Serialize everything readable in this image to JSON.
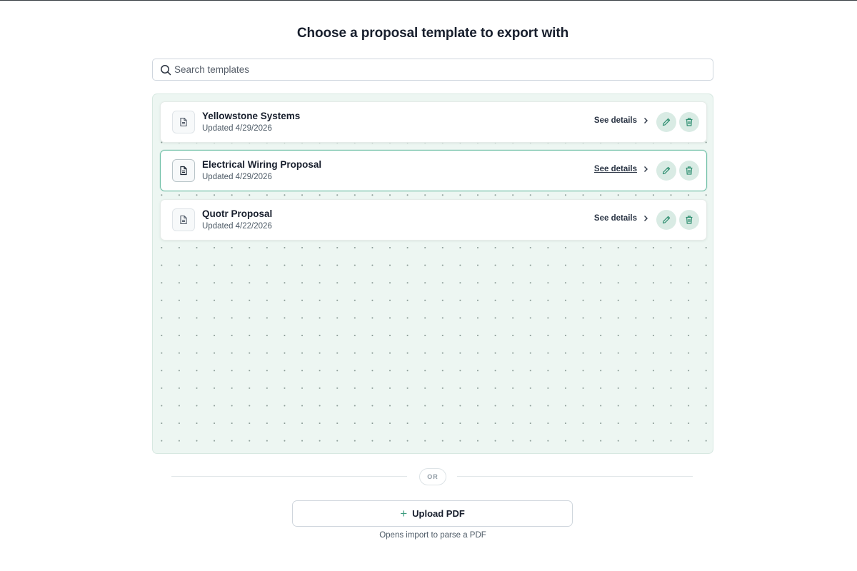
{
  "header": {
    "title": "Choose a proposal template to export with"
  },
  "search": {
    "placeholder": "Search templates",
    "value": ""
  },
  "templates": [
    {
      "name": "Yellowstone Systems",
      "updated": "Updated 4/29/2026",
      "details_label": "See details",
      "selected": false
    },
    {
      "name": "Electrical Wiring Proposal",
      "updated": "Updated 4/29/2026",
      "details_label": "See details",
      "selected": true
    },
    {
      "name": "Quotr Proposal",
      "updated": "Updated 4/22/2026",
      "details_label": "See details",
      "selected": false
    }
  ],
  "divider": {
    "label": "OR"
  },
  "upload": {
    "label": "Upload PDF",
    "hint": "Opens import to parse a PDF"
  },
  "icons": {
    "search": "search-icon",
    "document": "document-icon",
    "chevron": "chevron-right-icon",
    "edit": "pencil-icon",
    "delete": "trash-icon",
    "plus": "plus-icon"
  },
  "colors": {
    "accent": "#3a9b7d",
    "panel_bg": "#edf6f2",
    "selected_border": "#6fbfa6",
    "icon_button_bg": "#d9ebe4"
  }
}
